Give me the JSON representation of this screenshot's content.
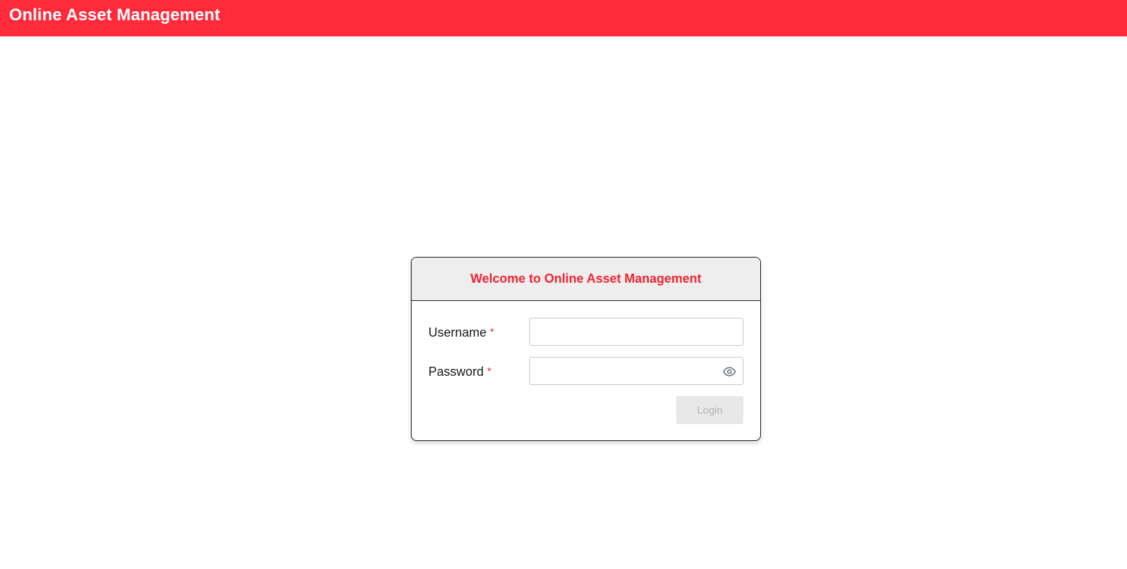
{
  "header": {
    "app_title": "Online Asset Management",
    "brand_color": "#ff2a3a"
  },
  "login": {
    "title": "Welcome to Online Asset Management",
    "username_label": "Username",
    "password_label": "Password",
    "required_mark": "*",
    "username_value": "",
    "password_value": "",
    "show_password_icon": "eye-icon",
    "login_button_label": "Login",
    "login_button_state": "disabled"
  }
}
